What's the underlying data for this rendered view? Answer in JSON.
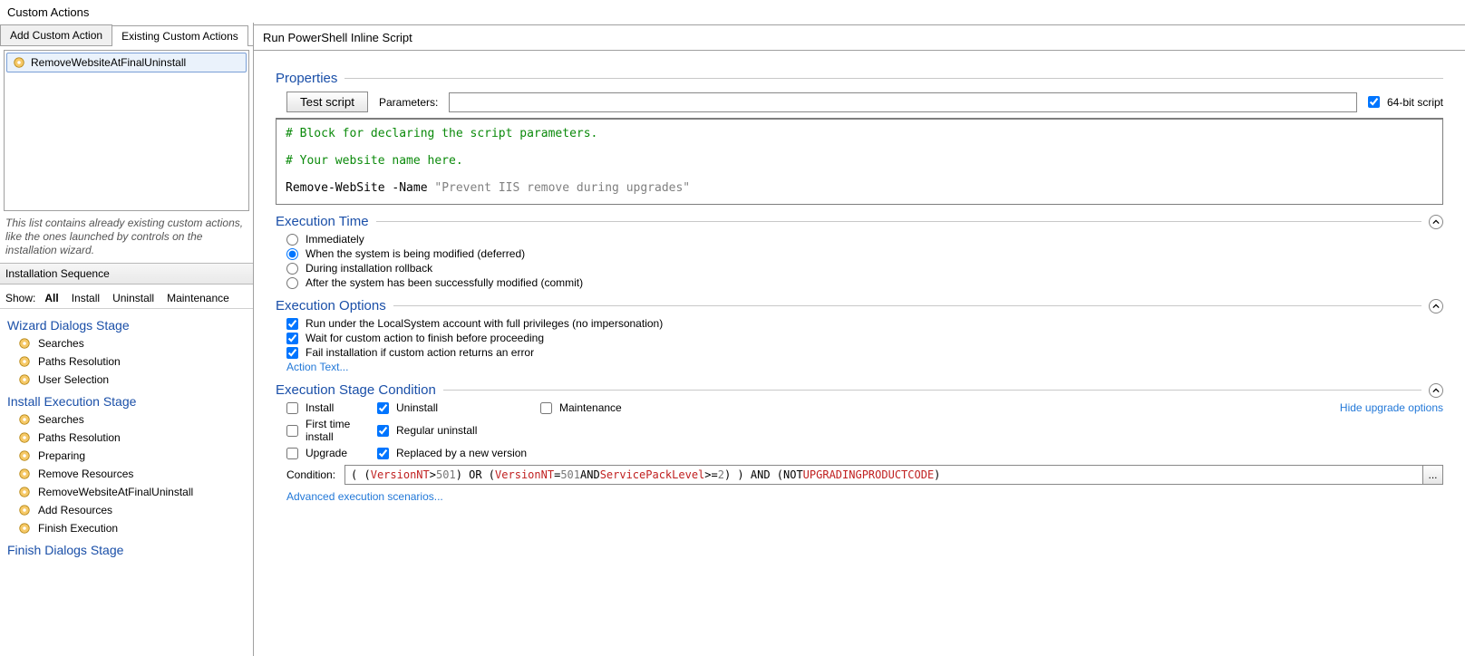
{
  "title": "Custom Actions",
  "tabs": {
    "add": "Add Custom Action",
    "existing": "Existing Custom Actions"
  },
  "ca_list": {
    "items": [
      "RemoveWebsiteAtFinalUninstall"
    ]
  },
  "ca_hint": "This list contains already existing custom actions, like the ones launched by controls on the installation wizard.",
  "seq": {
    "header": "Installation Sequence",
    "show_label": "Show:",
    "filters": {
      "all": "All",
      "install": "Install",
      "uninstall": "Uninstall",
      "maintenance": "Maintenance"
    },
    "wizard_stage": "Wizard Dialogs Stage",
    "wizard_items": [
      "Searches",
      "Paths Resolution",
      "User Selection"
    ],
    "install_stage": "Install Execution Stage",
    "install_items": [
      "Searches",
      "Paths Resolution",
      "Preparing",
      "Remove Resources",
      "RemoveWebsiteAtFinalUninstall",
      "Add Resources",
      "Finish Execution"
    ],
    "finish_stage": "Finish Dialogs Stage"
  },
  "right": {
    "subheader": "Run PowerShell Inline Script",
    "properties_title": "Properties",
    "test_script": "Test script",
    "parameters_label": "Parameters:",
    "parameters_value": "",
    "bit64_label": "64-bit script",
    "script": {
      "line1": "# Block for declaring the script parameters.",
      "line2": "# Your website name here.",
      "cmd": "Remove-WebSite -Name ",
      "str": "\"Prevent IIS remove during upgrades\""
    },
    "exec_time": {
      "title": "Execution Time",
      "immediately": "Immediately",
      "deferred": "When the system is being modified (deferred)",
      "rollback": "During installation rollback",
      "commit": "After the system has been successfully modified (commit)"
    },
    "exec_opts": {
      "title": "Execution Options",
      "local_system": "Run under the LocalSystem account with full privileges (no impersonation)",
      "wait": "Wait for custom action to finish before proceeding",
      "fail": "Fail installation if custom action returns an error",
      "action_text": "Action Text..."
    },
    "stage_cond": {
      "title": "Execution Stage Condition",
      "install": "Install",
      "uninstall": "Uninstall",
      "maintenance": "Maintenance",
      "first_time": "First time install",
      "regular_uninstall": "Regular uninstall",
      "upgrade": "Upgrade",
      "replaced": "Replaced by a new version",
      "hide_upgrade": "Hide upgrade options",
      "condition_label": "Condition:",
      "condition_tokens": [
        {
          "t": "( (",
          "c": "kw-op"
        },
        {
          "t": "VersionNT",
          "c": "kw-var"
        },
        {
          "t": " > ",
          "c": "kw-op"
        },
        {
          "t": "501",
          "c": "kw-num"
        },
        {
          "t": ") OR (",
          "c": "kw-op"
        },
        {
          "t": "VersionNT",
          "c": "kw-var"
        },
        {
          "t": " = ",
          "c": "kw-op"
        },
        {
          "t": "501",
          "c": "kw-num"
        },
        {
          "t": " AND ",
          "c": "kw-op"
        },
        {
          "t": "ServicePackLevel",
          "c": "kw-var"
        },
        {
          "t": " >= ",
          "c": "kw-op"
        },
        {
          "t": "2",
          "c": "kw-num"
        },
        {
          "t": ") )  AND (NOT ",
          "c": "kw-op"
        },
        {
          "t": "UPGRADINGPRODUCTCODE",
          "c": "kw-const"
        },
        {
          "t": " )",
          "c": "kw-op"
        }
      ],
      "browse": "...",
      "advanced": "Advanced execution scenarios..."
    }
  }
}
